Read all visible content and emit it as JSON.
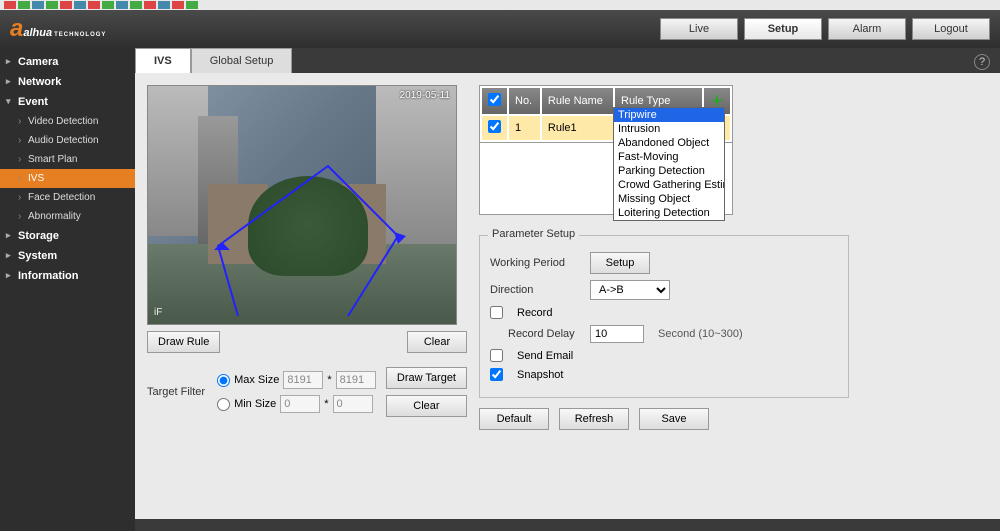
{
  "brand": {
    "name": "alhua",
    "sub": "TECHNOLOGY"
  },
  "header_buttons": {
    "live": "Live",
    "setup": "Setup",
    "alarm": "Alarm",
    "logout": "Logout"
  },
  "sidebar": {
    "camera": "Camera",
    "network": "Network",
    "event": "Event",
    "video_detection": "Video Detection",
    "audio_detection": "Audio Detection",
    "smart_plan": "Smart Plan",
    "ivs": "IVS",
    "face_detection": "Face Detection",
    "abnormality": "Abnormality",
    "storage": "Storage",
    "system": "System",
    "information": "Information"
  },
  "tabs": {
    "ivs": "IVS",
    "global": "Global Setup"
  },
  "video": {
    "timestamp": "2019-05-11 ",
    "iflabel": "iF"
  },
  "buttons": {
    "draw_rule": "Draw Rule",
    "clear": "Clear",
    "draw_target": "Draw Target",
    "setup": "Setup",
    "default": "Default",
    "refresh": "Refresh",
    "save": "Save"
  },
  "filter": {
    "label": "Target Filter",
    "max": "Max Size",
    "min": "Min Size",
    "max_w": "8191",
    "max_h": "8191",
    "min_w": "0",
    "min_h": "0",
    "sep": "*"
  },
  "rule_table": {
    "hdr_no": "No.",
    "hdr_name": "Rule Name",
    "hdr_type": "Rule Type",
    "row_no": "1",
    "row_name": "Rule1",
    "row_type": "Tripwire"
  },
  "rule_types": [
    "Tripwire",
    "Intrusion",
    "Abandoned Object",
    "Fast-Moving",
    "Parking Detection",
    "Crowd Gathering Estimation",
    "Missing Object",
    "Loitering Detection"
  ],
  "param": {
    "legend": "Parameter Setup",
    "working_period": "Working Period",
    "direction": "Direction",
    "direction_val": "A->B",
    "record": "Record",
    "record_delay": "Record Delay",
    "record_delay_val": "10",
    "record_hint": "Second (10~300)",
    "send_email": "Send Email",
    "snapshot": "Snapshot"
  }
}
